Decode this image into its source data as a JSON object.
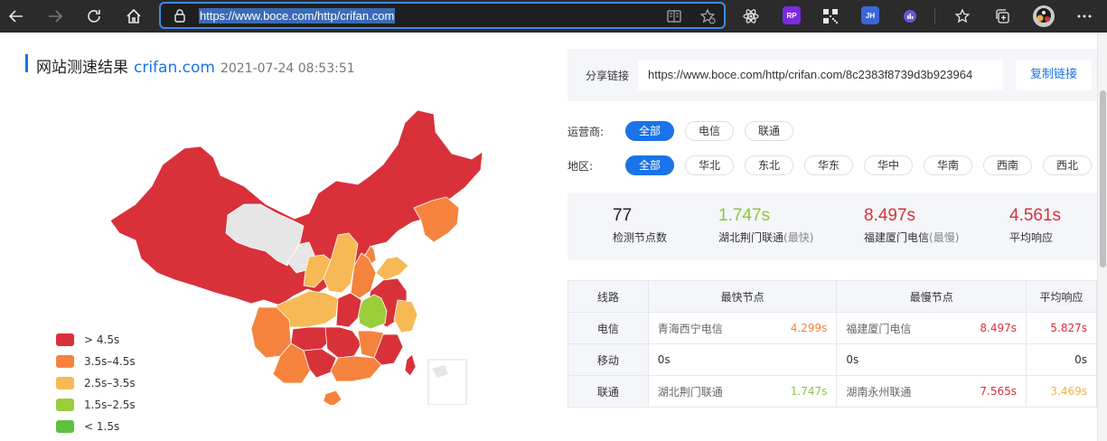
{
  "browser": {
    "url": "https://www.boce.com/http/crifan.com",
    "extensions": [
      {
        "name": "rp-extension",
        "label": "RP",
        "color": "#7b2ae0"
      },
      {
        "name": "qr-extension",
        "label": "",
        "color": "#2b2b2b"
      },
      {
        "name": "jh-extension",
        "label": "JH",
        "color": "#3b67d6"
      },
      {
        "name": "stats-extension",
        "label": "",
        "color": "#6a55d8"
      }
    ]
  },
  "page": {
    "title": "网站测速结果",
    "site": "crifan.com",
    "timestamp": "2021-07-24 08:53:51"
  },
  "legend": [
    {
      "label": "> 4.5s",
      "color": "#d9313a"
    },
    {
      "label": "3.5s–4.5s",
      "color": "#f5833d"
    },
    {
      "label": "2.5s–3.5s",
      "color": "#f7b955"
    },
    {
      "label": "1.5s–2.5s",
      "color": "#9acd3a"
    },
    {
      "label": "< 1.5s",
      "color": "#5ec23e"
    }
  ],
  "share": {
    "label": "分享链接",
    "url": "https://www.boce.com/http/crifan.com/8c2383f8739d3b923964",
    "copy_label": "复制链接"
  },
  "filters": {
    "isp_label": "运营商:",
    "isps": [
      "全部",
      "电信",
      "联通"
    ],
    "region_label": "地区:",
    "regions": [
      "全部",
      "华北",
      "东北",
      "华东",
      "华中",
      "华南",
      "西南",
      "西北"
    ]
  },
  "stats": {
    "nodes_value": "77",
    "nodes_label": "检测节点数",
    "fastest_value": "1.747s",
    "fastest_label": "湖北荆门联通",
    "fastest_tag": "(最快)",
    "slowest_value": "8.497s",
    "slowest_label": "福建厦门电信",
    "slowest_tag": "(最慢)",
    "avg_value": "4.561s",
    "avg_label": "平均响应"
  },
  "table": {
    "headers": [
      "线路",
      "最快节点",
      "最慢节点",
      "平均响应"
    ],
    "rows": [
      {
        "line": "电信",
        "fast_node": "青海西宁电信",
        "fast_time": "4.299s",
        "slow_node": "福建厦门电信",
        "slow_time": "8.497s",
        "avg": "5.827s"
      },
      {
        "line": "移动",
        "fast_node": "0s",
        "fast_time": "",
        "slow_node": "0s",
        "slow_time": "",
        "avg": "0s"
      },
      {
        "line": "联通",
        "fast_node": "湖北荆门联通",
        "fast_time": "1.747s",
        "slow_node": "湖南永州联通",
        "slow_time": "7.565s",
        "avg": "3.469s"
      }
    ]
  },
  "colors": {
    "accent": "#1a73e8",
    "fast": "#8cc63f",
    "slow": "#d8313a",
    "orange": "#f5833d",
    "yellow": "#f0b440"
  }
}
